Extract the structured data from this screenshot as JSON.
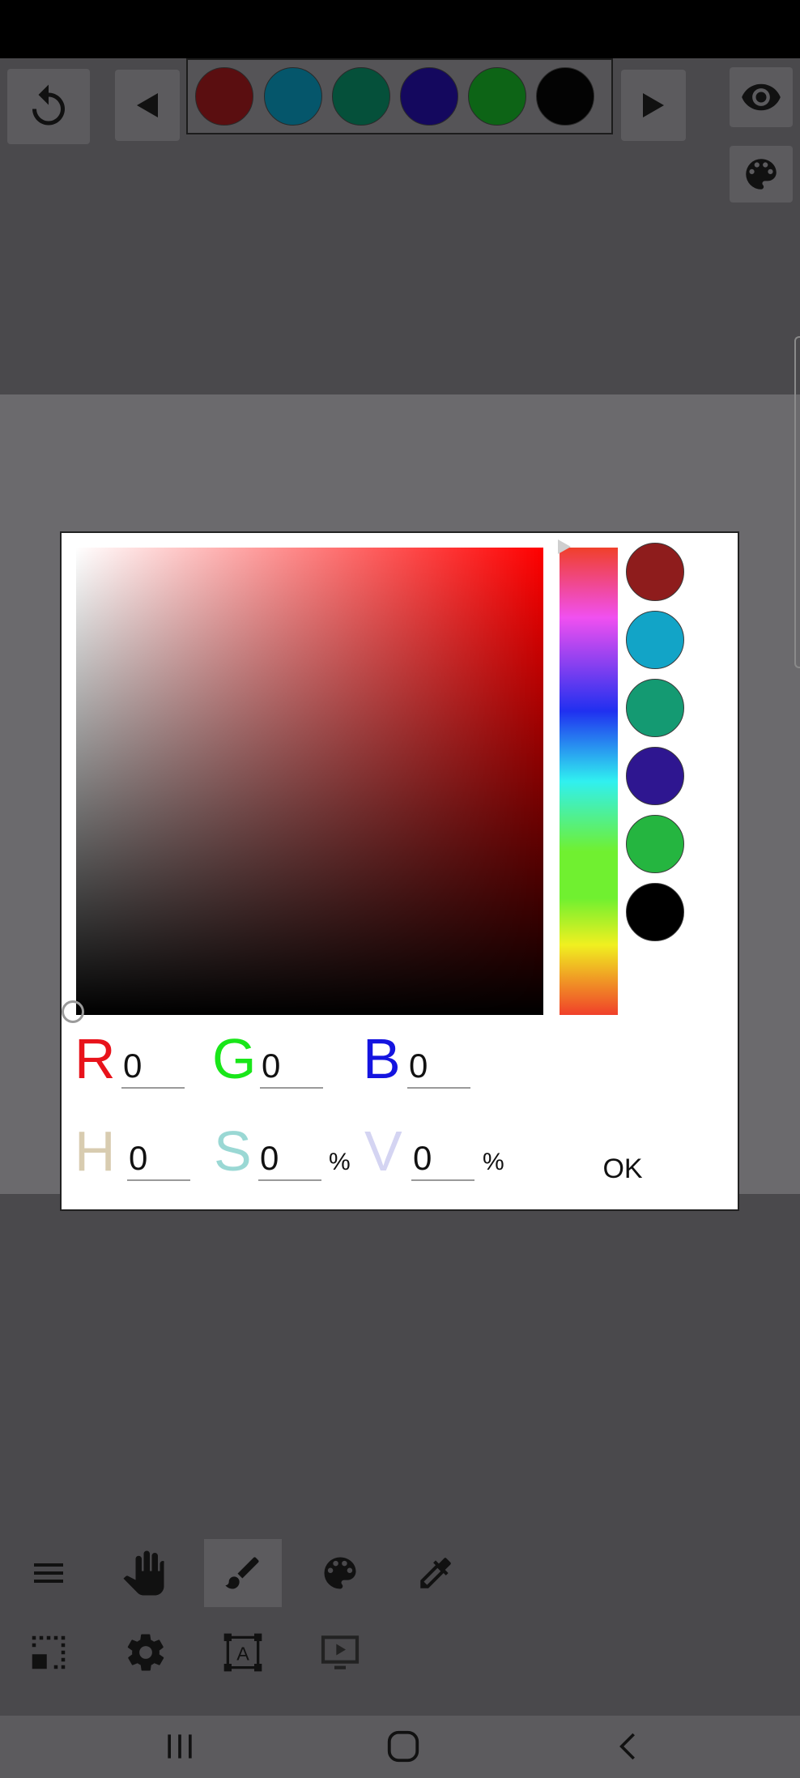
{
  "toolbar": {
    "undo_icon": "undo-icon",
    "prev_icon": "triangle-left-icon",
    "next_icon": "triangle-right-icon",
    "eye_icon": "eye-icon",
    "palette_icon": "palette-icon",
    "recent_colors": [
      "#5a0e10",
      "#05566b",
      "#05503a",
      "#14085e",
      "#0d6416",
      "#030303"
    ]
  },
  "color_dialog": {
    "hue_color": "#ff0000",
    "preset_colors": [
      "#8e1c1c",
      "#12a4c7",
      "#149a72",
      "#2e1690",
      "#25b540",
      "#000000"
    ],
    "rgb": {
      "r_label": "R",
      "r_value": "0",
      "g_label": "G",
      "g_value": "0",
      "b_label": "B",
      "b_value": "0"
    },
    "hsv": {
      "h_label": "H",
      "h_value": "0",
      "s_label": "S",
      "s_value": "0",
      "s_unit": "%",
      "v_label": "V",
      "v_value": "0",
      "v_unit": "%"
    },
    "ok_label": "OK",
    "label_colors": {
      "r": "#e8131b",
      "g": "#19e619",
      "b": "#1414e0",
      "h": "#d8ccb0",
      "s": "#9ad8d4",
      "v": "#d4d4f2"
    }
  },
  "bottom_tools": {
    "row1": [
      "menu-icon",
      "hand-icon",
      "brush-icon",
      "palette-icon",
      "eyedropper-icon"
    ],
    "row2": [
      "selection-icon",
      "gear-icon",
      "text-frame-icon",
      "play-screen-icon"
    ]
  },
  "navbar": [
    "recent-apps-icon",
    "home-icon",
    "back-icon"
  ]
}
